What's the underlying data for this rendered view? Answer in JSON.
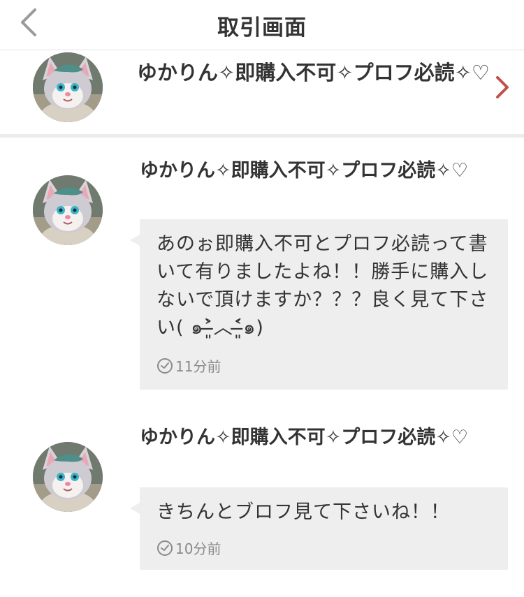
{
  "header": {
    "title": "取引画面",
    "back_icon": "chevron-left-icon"
  },
  "seller": {
    "name": "ゆかりん✧即購入不可✧プロフ必読✧♡",
    "avatar_icon": "cat-mascot-avatar",
    "chevron_icon": "chevron-right-icon",
    "chevron_color": "#c0504d"
  },
  "messages": [
    {
      "sender": "ゆかりん✧即購入不可✧プロフ必読✧♡",
      "text": "あのぉ即購入不可とプロフ必読って書いて有りましたよね！！勝手に購入しないで頂けますか？？？良く見て下さい( ๑˃̶͈̀︿˂̶͈́๑)",
      "time": "11分前",
      "time_icon": "clock-check-icon"
    },
    {
      "sender": "ゆかりん✧即購入不可✧プロフ必読✧♡",
      "text": "きちんとブロフ見て下さいね！！",
      "time": "10分前",
      "time_icon": "clock-check-icon"
    }
  ],
  "colors": {
    "bubble": "#eeeeee",
    "divider": "#ececec",
    "text": "#333333",
    "muted": "#8a8a8a"
  }
}
